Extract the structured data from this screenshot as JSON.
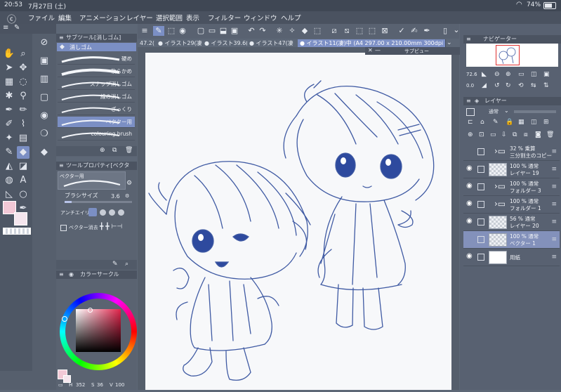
{
  "status": {
    "time": "20:53",
    "date": "7月27日 (土)",
    "battery": "74%",
    "battery_icon": "battery-icon",
    "wifi_icon": "wifi-icon"
  },
  "menu": {
    "items": [
      "ファイル",
      "編集",
      "アニメーション",
      "レイヤー",
      "選択範囲",
      "表示",
      "フィルター",
      "ウィンドウ",
      "ヘルプ"
    ]
  },
  "tabs": [
    {
      "label": "47.2("
    },
    {
      "label": "● イラスト29(凄"
    },
    {
      "label": "● イラスト39.6("
    },
    {
      "label": "● イラスト47(凄"
    },
    {
      "label": "● イラスト11(凄)中 (A4 297.00 x 210.00mm 300dpi 72.6%)"
    }
  ],
  "subview": {
    "title": "サブビュー"
  },
  "subtool": {
    "header": "サブツール[消しゴム]",
    "group": "消しゴム",
    "brushes": [
      "硬め",
      "軟らかめ",
      "スナップ消しゴム",
      "線の消しゴム",
      "ざっくり",
      "ベクター用",
      "colouring brush"
    ],
    "selected_index": 5
  },
  "tool_property": {
    "header": "ツールプロパティ[ベクタ",
    "preview_label": "ベクター用",
    "brush_size_label": "ブラシサイズ",
    "brush_size_value": "3.6",
    "antialias_label": "アンチエイリ",
    "vector_erase_label": "ベクター消去"
  },
  "color": {
    "header": "カラーサークル",
    "readout_h": "352",
    "readout_s": "36",
    "readout_v": "100",
    "main_color": "#f2c8d6",
    "sub_color": "#f5e6ee"
  },
  "navigator": {
    "header": "ナビゲーター",
    "zoom": "72.6",
    "rotate": "0.0"
  },
  "layers": {
    "header": "レイヤー",
    "blend_mode": "通常",
    "rows": [
      {
        "kind": "folder",
        "line1": "32 % 乗算",
        "line2": "三分割主のコピー",
        "visible": false,
        "selected": false
      },
      {
        "kind": "raster",
        "line1": "100 % 通常",
        "line2": "レイヤー 19",
        "visible": true,
        "selected": false
      },
      {
        "kind": "folder",
        "line1": "100 % 通常",
        "line2": "フォルダー 3",
        "visible": true,
        "selected": false
      },
      {
        "kind": "folder",
        "line1": "100 % 通常",
        "line2": "フォルダー 1",
        "visible": true,
        "selected": false
      },
      {
        "kind": "raster",
        "line1": "56 % 通常",
        "line2": "レイヤー 20",
        "visible": true,
        "selected": false
      },
      {
        "kind": "raster",
        "line1": "100 % 通常",
        "line2": "ベクター 1",
        "visible": false,
        "selected": true
      },
      {
        "kind": "paper",
        "line1": "",
        "line2": "用紙",
        "visible": true,
        "selected": false
      }
    ]
  }
}
